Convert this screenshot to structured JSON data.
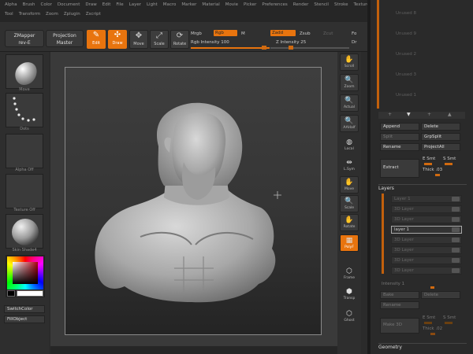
{
  "menu": {
    "row1": [
      "Alpha",
      "Brush",
      "Color",
      "Document",
      "Draw",
      "Edit",
      "File",
      "Layer",
      "Light",
      "Macro",
      "Marker",
      "Material",
      "Movie",
      "Picker",
      "Preferences",
      "Render",
      "Stencil",
      "Stroke",
      "Texture"
    ],
    "row2": [
      "Tool",
      "Transform",
      "Zoom",
      "Zplugin",
      "Zscript"
    ]
  },
  "toolbar": {
    "zmapper": "ZMapper",
    "zmapper_sub": "rev-E",
    "projection": "Projection",
    "projection_sub": "Master",
    "edit": "Edit",
    "draw": "Draw",
    "move": "Move",
    "scale": "Scale",
    "rotate": "Rotate",
    "mrgb": "Mrgb",
    "rgb": "Rgb",
    "m": "M",
    "rgb_intensity": "Rgb Intensity 100",
    "zadd": "Zadd",
    "zsub": "Zsub",
    "z_intensity": "Z Intensity 25",
    "zcut": "Zcut",
    "focal": "Fo",
    "draw_size": "Dr"
  },
  "shelf": {
    "brush_label": "Move",
    "stroke_label": "Dots",
    "alpha_label": "Alpha Off",
    "texture_label": "Texture Off",
    "material_label": "Skin Shade4",
    "switch_color": "SwitchColor",
    "fill_object": "FillObject"
  },
  "right_tools": [
    {
      "name": "scroll",
      "label": "Scroll",
      "glyph": "✋"
    },
    {
      "name": "zoom",
      "label": "Zoom",
      "glyph": "🔍"
    },
    {
      "name": "actual",
      "label": "Actual",
      "glyph": "🔍"
    },
    {
      "name": "aahalf",
      "label": "AAHalf",
      "glyph": "🔍"
    },
    {
      "name": "local",
      "label": "Local",
      "glyph": "◍"
    },
    {
      "name": "lsym",
      "label": "L.Sym",
      "glyph": "⇹"
    },
    {
      "name": "move",
      "label": "Move",
      "glyph": "✋"
    },
    {
      "name": "scale",
      "label": "Scale",
      "glyph": "🔍"
    },
    {
      "name": "rotate",
      "label": "Rotate",
      "glyph": "✋"
    },
    {
      "name": "polyf",
      "label": "PolyF",
      "glyph": "▦"
    },
    {
      "name": "frame",
      "label": "Frame",
      "glyph": "⬡"
    },
    {
      "name": "transp",
      "label": "Transp",
      "glyph": "⬢"
    },
    {
      "name": "ghost",
      "label": "Ghost",
      "glyph": "⬡"
    }
  ],
  "tray": {
    "subtools": [
      "Unused 8",
      "Unused 9",
      "Unused 2",
      "Unused 3",
      "Unused 1"
    ],
    "append": "Append",
    "delete": "Delete",
    "split": "Split",
    "grpsplit": "GrpSplit",
    "rename": "Rename",
    "projectall": "ProjectAll",
    "extract": "Extract",
    "esmt": "E Smt",
    "ssmt": "S Smt",
    "thick": "Thick .03",
    "layers_title": "Layers",
    "layers": [
      "Layer 1",
      "3D Layer",
      "3D Layer",
      "layer 1",
      "3D Layer",
      "3D Layer",
      "3D Layer",
      "3D Layer"
    ],
    "intensity": "Intensity 1",
    "bake": "Bake",
    "layers_delete": "Delete",
    "layers_rename": "Rename",
    "esmt2": "E Smt",
    "ssmt2": "S Smt",
    "thick2": "Thick .02",
    "make3d": "Make 3D",
    "geometry_title": "Geometry"
  }
}
